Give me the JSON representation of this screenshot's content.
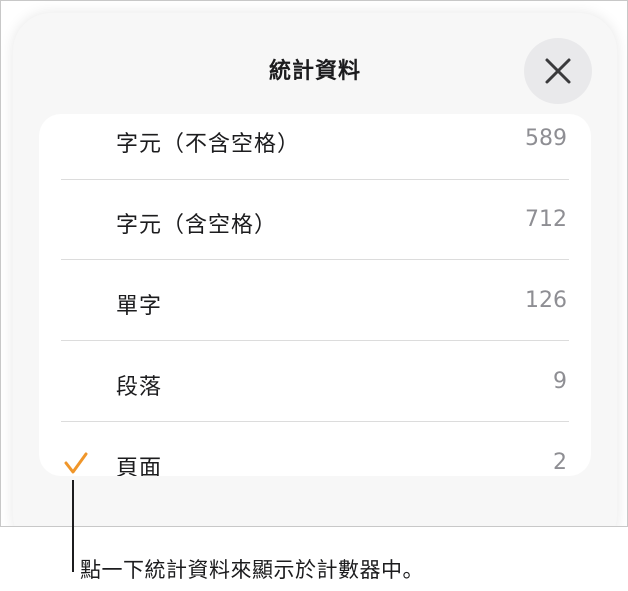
{
  "sheet": {
    "title": "統計資料",
    "close_icon": "close-icon"
  },
  "stats": [
    {
      "label": "字元（不含空格）",
      "value": "589",
      "selected": false
    },
    {
      "label": "字元（含空格）",
      "value": "712",
      "selected": false
    },
    {
      "label": "單字",
      "value": "126",
      "selected": false
    },
    {
      "label": "段落",
      "value": "9",
      "selected": false
    },
    {
      "label": "頁面",
      "value": "2",
      "selected": true
    }
  ],
  "check_icon": "checkmark-icon",
  "callout": {
    "text": "點一下統計資料來顯示於計數器中。"
  },
  "colors": {
    "accent": "#f0962a",
    "sheet_background": "#f7f7f7",
    "card_background": "#ffffff",
    "value_text": "#8e8e93"
  }
}
